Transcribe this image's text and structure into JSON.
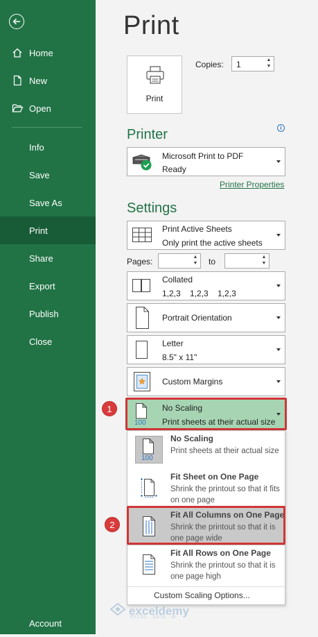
{
  "sidebar": {
    "items": [
      {
        "label": "Home",
        "icon": "home-icon"
      },
      {
        "label": "New",
        "icon": "new-document-icon"
      },
      {
        "label": "Open",
        "icon": "open-folder-icon"
      },
      {
        "label": "Info"
      },
      {
        "label": "Save"
      },
      {
        "label": "Save As"
      },
      {
        "label": "Print",
        "active": true
      },
      {
        "label": "Share"
      },
      {
        "label": "Export"
      },
      {
        "label": "Publish"
      },
      {
        "label": "Close"
      }
    ],
    "account": "Account"
  },
  "main": {
    "title": "Print",
    "print_button": "Print",
    "copies_label": "Copies:",
    "copies_value": "1",
    "printer_heading": "Printer",
    "printer": {
      "name": "Microsoft Print to PDF",
      "status": "Ready"
    },
    "printer_properties": "Printer Properties",
    "settings_heading": "Settings",
    "what_to_print": {
      "line1": "Print Active Sheets",
      "line2": "Only print the active sheets"
    },
    "pages_label": "Pages:",
    "to_label": "to",
    "collation": {
      "line1": "Collated",
      "line2": "1,2,3    1,2,3    1,2,3"
    },
    "orientation": {
      "line1": "Portrait Orientation"
    },
    "paper": {
      "line1": "Letter",
      "line2": "8.5\" x 11\""
    },
    "margins": {
      "line1": "Custom Margins"
    },
    "scaling": {
      "line1": "No Scaling",
      "line2": "Print sheets at their actual size"
    }
  },
  "scaling_menu": {
    "options": [
      {
        "title": "No Scaling",
        "desc": "Print sheets at their actual size"
      },
      {
        "title": "Fit Sheet on One Page",
        "desc": "Shrink the printout so that it fits on one page"
      },
      {
        "title": "Fit All Columns on One Page",
        "desc": "Shrink the printout so that it is one page wide"
      },
      {
        "title": "Fit All Rows on One Page",
        "desc": "Shrink the printout so that it is one page high"
      }
    ],
    "custom": "Custom Scaling Options..."
  },
  "callouts": {
    "one": "1",
    "two": "2"
  },
  "icon_text": {
    "scale_100": "100"
  },
  "watermark": {
    "name": "exceldemy",
    "tagline": "EXCEL · DATA · BI"
  },
  "colors": {
    "sidebar": "#217346",
    "sidebar_active": "#185c37",
    "heading": "#217346",
    "highlight": "#a7d5b3",
    "callout": "#d93b3b"
  }
}
